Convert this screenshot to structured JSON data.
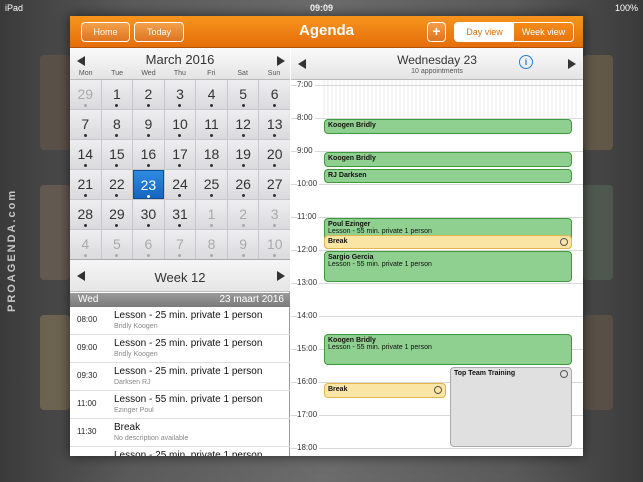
{
  "statusbar": {
    "device": "iPad",
    "time": "09:09",
    "battery": "100%"
  },
  "brand": "PROAGENDA.com",
  "topbar": {
    "home": "Home",
    "today": "Today",
    "title": "Agenda",
    "add": "+",
    "day_view": "Day view",
    "week_view": "Week view"
  },
  "month": {
    "title": "March 2016",
    "dows": [
      "Mon",
      "Tue",
      "Wed",
      "Thu",
      "Fri",
      "Sat",
      "Sun"
    ],
    "days": [
      {
        "n": "29",
        "dim": true,
        "dot": true
      },
      {
        "n": "1",
        "dot": true
      },
      {
        "n": "2",
        "dot": true
      },
      {
        "n": "3",
        "dot": true
      },
      {
        "n": "4",
        "dot": true
      },
      {
        "n": "5",
        "dot": true
      },
      {
        "n": "6",
        "dot": true
      },
      {
        "n": "7",
        "dot": true
      },
      {
        "n": "8",
        "dot": true
      },
      {
        "n": "9",
        "dot": true
      },
      {
        "n": "10",
        "dot": true
      },
      {
        "n": "11",
        "dot": true
      },
      {
        "n": "12",
        "dot": true
      },
      {
        "n": "13",
        "dot": true
      },
      {
        "n": "14",
        "dot": true
      },
      {
        "n": "15",
        "dot": true
      },
      {
        "n": "16",
        "dot": true
      },
      {
        "n": "17",
        "dot": true
      },
      {
        "n": "18",
        "dot": true
      },
      {
        "n": "19",
        "dot": true
      },
      {
        "n": "20",
        "dot": true
      },
      {
        "n": "21",
        "dot": true
      },
      {
        "n": "22",
        "dot": true
      },
      {
        "n": "23",
        "dot": true,
        "sel": true
      },
      {
        "n": "24",
        "dot": true
      },
      {
        "n": "25",
        "dot": true
      },
      {
        "n": "26",
        "dot": true
      },
      {
        "n": "27",
        "dot": true
      },
      {
        "n": "28",
        "dot": true
      },
      {
        "n": "29",
        "dot": true
      },
      {
        "n": "30",
        "dot": true
      },
      {
        "n": "31",
        "dot": true
      },
      {
        "n": "1",
        "dim": true,
        "dot": true
      },
      {
        "n": "2",
        "dim": true,
        "dot": true
      },
      {
        "n": "3",
        "dim": true,
        "dot": true
      },
      {
        "n": "4",
        "dim": true,
        "dot": true
      },
      {
        "n": "5",
        "dim": true,
        "dot": true
      },
      {
        "n": "6",
        "dim": true,
        "dot": true
      },
      {
        "n": "7",
        "dim": true,
        "dot": true
      },
      {
        "n": "8",
        "dim": true,
        "dot": true
      },
      {
        "n": "9",
        "dim": true,
        "dot": true
      },
      {
        "n": "10",
        "dim": true,
        "dot": true
      }
    ]
  },
  "week": {
    "title": "Week 12",
    "day_short": "Wed",
    "date_label": "23 maart 2016"
  },
  "list": [
    {
      "time": "08:00",
      "title": "Lesson - 25 min. private 1 person",
      "sub": "Bridly Koogen"
    },
    {
      "time": "09:00",
      "title": "Lesson - 25 min. private 1 person",
      "sub": "Bridly Koogen"
    },
    {
      "time": "09:30",
      "title": "Lesson - 25 min. private 1 person",
      "sub": "Darksen RJ"
    },
    {
      "time": "11:00",
      "title": "Lesson - 55 min. private 1 person",
      "sub": "Ezinger Poul"
    },
    {
      "time": "11:30",
      "title": "Break",
      "sub": "No description available"
    },
    {
      "time": "",
      "title": "Lesson - 25 min. private 1 person",
      "sub": ""
    }
  ],
  "day": {
    "title": "Wednesday 23",
    "subtitle": "10 appointments",
    "info": "i",
    "hours": [
      "7:00",
      "8:00",
      "9:00",
      "10:00",
      "11:00",
      "12:00",
      "13:00",
      "14:00",
      "15:00",
      "16:00",
      "17:00",
      "18:00"
    ],
    "events": [
      {
        "name": "Koogen Bridly",
        "desc": "",
        "color": "g",
        "start": 8.0,
        "end": 8.5,
        "col": 0
      },
      {
        "name": "Koogen Bridly",
        "desc": "",
        "color": "g",
        "start": 9.0,
        "end": 9.5,
        "col": 0
      },
      {
        "name": "RJ Darksen",
        "desc": "",
        "color": "g",
        "start": 9.5,
        "end": 10.0,
        "col": 0
      },
      {
        "name": "Poul Ezinger",
        "desc": "Lesson - 55 min. private 1 person",
        "color": "g",
        "start": 11.0,
        "end": 12.0,
        "col": 0
      },
      {
        "name": "Break",
        "desc": "",
        "color": "y",
        "start": 11.5,
        "end": 12.0,
        "col": 0,
        "repeat": true
      },
      {
        "name": "Sargio Gercia",
        "desc": "Lesson - 55 min. private 1 person",
        "color": "g",
        "start": 12.0,
        "end": 13.0,
        "col": 0
      },
      {
        "name": "Koogen Bridly",
        "desc": "Lesson - 55 min. private 1 person",
        "color": "g",
        "start": 14.5,
        "end": 15.5,
        "col": 0
      },
      {
        "name": "Break",
        "desc": "",
        "color": "y",
        "start": 16.0,
        "end": 16.5,
        "col": 1,
        "repeat": true
      },
      {
        "name": "Top Team Training",
        "desc": "",
        "color": "gr",
        "start": 15.5,
        "end": 18.0,
        "col": 2,
        "repeat": true
      }
    ]
  }
}
